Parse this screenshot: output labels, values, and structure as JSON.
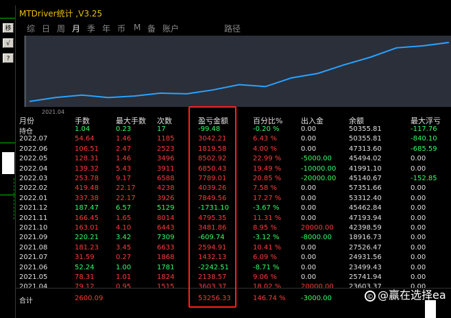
{
  "window": {
    "title": "MTDriver统计 ,V3.25"
  },
  "toolbar": {
    "buttons": [
      "移",
      "√",
      "?"
    ]
  },
  "tabs": [
    "综",
    "日",
    "周",
    "月",
    "季",
    "年",
    "币",
    "M",
    "备",
    "账户",
    "路径"
  ],
  "active_tab": "月",
  "chart": {
    "start_label": "2021.04"
  },
  "columns": [
    "月份",
    "手数",
    "最大手数",
    "次数",
    "盈亏金额",
    "百分比%",
    "出入金",
    "余额",
    "最大浮亏"
  ],
  "rows": [
    {
      "month": "持仓",
      "lots": "1.04",
      "max_lots": "0.23",
      "count": "17",
      "pnl": "-99.48",
      "pct": "-0.20 %",
      "flow": "0.00",
      "balance": "50355.81",
      "max_float": "-117.76"
    },
    {
      "month": "2022.07",
      "lots": "54.64",
      "max_lots": "1.46",
      "count": "1185",
      "pnl": "3042.21",
      "pct": "6.43 %",
      "flow": "0.00",
      "balance": "50355.81",
      "max_float": "-840.10"
    },
    {
      "month": "2022.06",
      "lots": "106.51",
      "max_lots": "2.47",
      "count": "2523",
      "pnl": "1819.58",
      "pct": "4.00 %",
      "flow": "0.00",
      "balance": "47313.60",
      "max_float": "-685.59"
    },
    {
      "month": "2022.05",
      "lots": "128.31",
      "max_lots": "1.46",
      "count": "3496",
      "pnl": "8502.92",
      "pct": "22.99 %",
      "flow": "-5000.00",
      "balance": "45494.02",
      "max_float": "0.00"
    },
    {
      "month": "2022.04",
      "lots": "139.32",
      "max_lots": "5.43",
      "count": "3911",
      "pnl": "6850.43",
      "pct": "19.49 %",
      "flow": "-10000.00",
      "balance": "41991.10",
      "max_float": "0.00"
    },
    {
      "month": "2022.03",
      "lots": "253.78",
      "max_lots": "9.17",
      "count": "6588",
      "pnl": "7789.01",
      "pct": "20.85 %",
      "flow": "-20000.00",
      "balance": "45140.67",
      "max_float": "-152.85"
    },
    {
      "month": "2022.02",
      "lots": "419.48",
      "max_lots": "22.17",
      "count": "4238",
      "pnl": "4039.26",
      "pct": "7.58 %",
      "flow": "0.00",
      "balance": "57351.66",
      "max_float": "0.00"
    },
    {
      "month": "2022.01",
      "lots": "337.38",
      "max_lots": "22.17",
      "count": "3926",
      "pnl": "7849.56",
      "pct": "17.27 %",
      "flow": "0.00",
      "balance": "53312.40",
      "max_float": "0.00"
    },
    {
      "month": "2021.12",
      "lots": "187.47",
      "max_lots": "6.57",
      "count": "5129",
      "pnl": "-1731.10",
      "pct": "-3.67 %",
      "flow": "0.00",
      "balance": "45462.84",
      "max_float": "0.00"
    },
    {
      "month": "2021.11",
      "lots": "166.45",
      "max_lots": "1.65",
      "count": "8014",
      "pnl": "4795.35",
      "pct": "11.31 %",
      "flow": "0.00",
      "balance": "47193.94",
      "max_float": "0.00"
    },
    {
      "month": "2021.10",
      "lots": "163.01",
      "max_lots": "4.10",
      "count": "6443",
      "pnl": "3481.86",
      "pct": "8.95 %",
      "flow": "20000.00",
      "balance": "42398.59",
      "max_float": "0.00"
    },
    {
      "month": "2021.09",
      "lots": "220.21",
      "max_lots": "3.42",
      "count": "7309",
      "pnl": "-609.74",
      "pct": "-3.12 %",
      "flow": "-8000.00",
      "balance": "18916.73",
      "max_float": "0.00"
    },
    {
      "month": "2021.08",
      "lots": "181.23",
      "max_lots": "3.45",
      "count": "6633",
      "pnl": "2594.91",
      "pct": "10.41 %",
      "flow": "0.00",
      "balance": "27526.47",
      "max_float": "0.00"
    },
    {
      "month": "2021.07",
      "lots": "31.59",
      "max_lots": "0.27",
      "count": "1868",
      "pnl": "1432.13",
      "pct": "6.09 %",
      "flow": "0.00",
      "balance": "24931.56",
      "max_float": "0.00"
    },
    {
      "month": "2021.06",
      "lots": "52.24",
      "max_lots": "1.00",
      "count": "1781",
      "pnl": "-2242.51",
      "pct": "-8.71 %",
      "flow": "0.00",
      "balance": "23499.43",
      "max_float": "0.00"
    },
    {
      "month": "2021.05",
      "lots": "78.31",
      "max_lots": "1.01",
      "count": "1824",
      "pnl": "2138.57",
      "pct": "9.06 %",
      "flow": "0.00",
      "balance": "25741.94",
      "max_float": "0.00"
    },
    {
      "month": "2021.04",
      "lots": "79.12",
      "max_lots": "0.95",
      "count": "1515",
      "pnl": "3603.37",
      "pct": "18.02 %",
      "flow": "20000.00",
      "balance": "23603.37",
      "max_float": "0.00"
    }
  ],
  "total": {
    "label": "合计",
    "lots": "2600.09",
    "pnl": "53256.33",
    "pct": "146.74 %",
    "flow": "-3000.00"
  },
  "watermark": "@赢在选择ea",
  "colors": {
    "positive": "#ff3b3b",
    "negative": "#33ff66",
    "neutral": "#e0e0e0",
    "title": "#f0c000",
    "highlight": "#ff2020"
  }
}
